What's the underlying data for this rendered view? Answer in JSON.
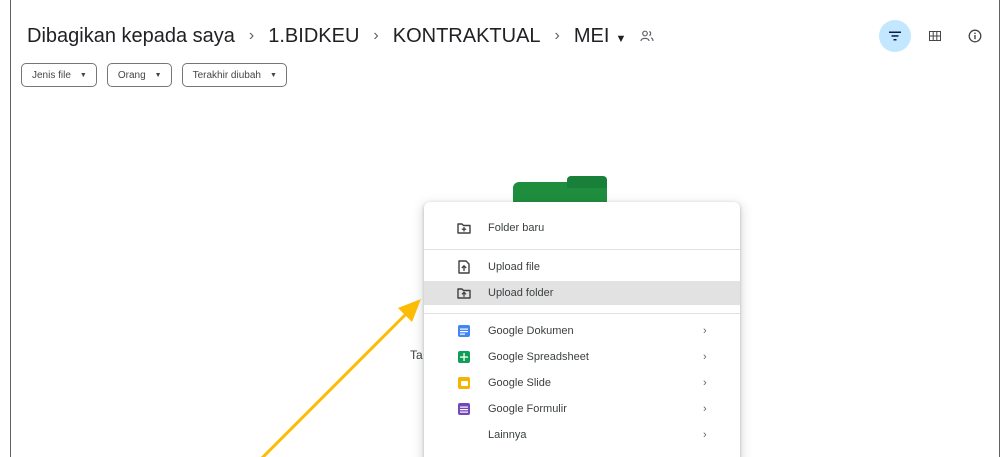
{
  "breadcrumb": {
    "items": [
      "Dibagikan kepada saya",
      "1.BIDKEU",
      "KONTRAKTUAL",
      "MEI"
    ],
    "separator": "›"
  },
  "filters": [
    "Jenis file",
    "Orang",
    "Terakhir diubah"
  ],
  "empty_state_partial_text": "Ta",
  "menu": {
    "section1": [
      {
        "label": "Folder baru",
        "icon": "new-folder-icon"
      }
    ],
    "section2": [
      {
        "label": "Upload file",
        "icon": "upload-file-icon"
      },
      {
        "label": "Upload folder",
        "icon": "upload-folder-icon",
        "highlighted": true
      }
    ],
    "section3": [
      {
        "label": "Google Dokumen",
        "icon": "google-docs-icon",
        "color": "#4285f4"
      },
      {
        "label": "Google Spreadsheet",
        "icon": "google-sheets-icon",
        "color": "#0f9d58"
      },
      {
        "label": "Google Slide",
        "icon": "google-slides-icon",
        "color": "#f4b400"
      },
      {
        "label": "Google Formulir",
        "icon": "google-forms-icon",
        "color": "#7248b9"
      },
      {
        "label": "Lainnya",
        "icon": ""
      }
    ]
  },
  "colors": {
    "accent": "#c2e7ff",
    "highlight": "#e2e2e2",
    "annotation_arrow": "#fbbc04",
    "folder_green": "#1e8e3e"
  }
}
